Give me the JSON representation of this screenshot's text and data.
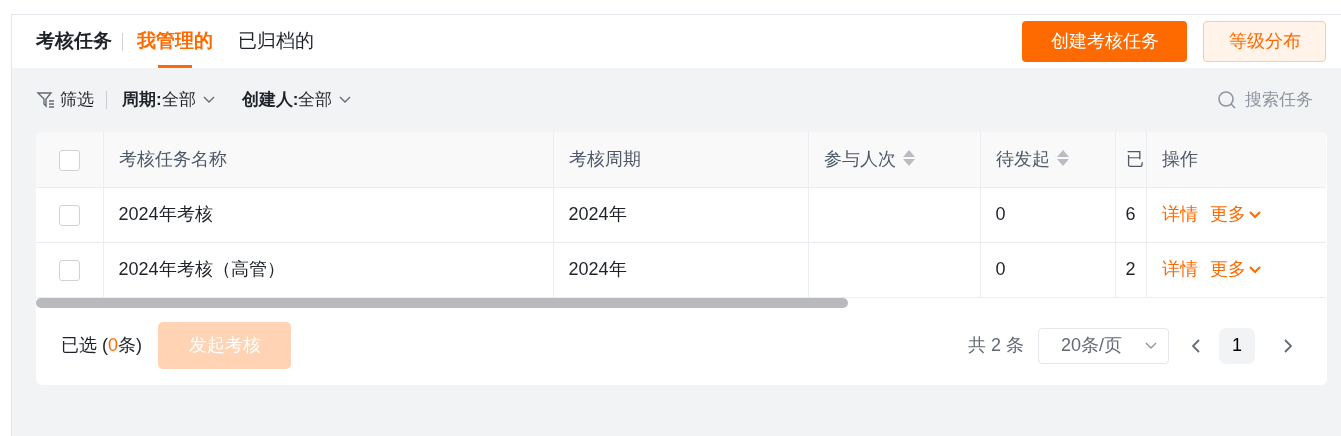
{
  "title": "考核任务",
  "tabs": [
    {
      "label": "我管理的",
      "selected": true
    },
    {
      "label": "已归档的",
      "selected": false
    }
  ],
  "actions": [
    {
      "label": "创建考核任务",
      "kind": "primary"
    },
    {
      "label": "等级分布",
      "kind": "secondary"
    }
  ],
  "filters": {
    "label": "筛选",
    "items": [
      {
        "label": "周期:",
        "value": "全部"
      },
      {
        "label": "创建人:",
        "value": "全部"
      }
    ]
  },
  "search": {
    "placeholder": "搜索任务"
  },
  "table": {
    "select_all": {
      "checked": false
    },
    "columns": [
      {
        "label": "考核任务名称",
        "sortable": false
      },
      {
        "label": "考核周期",
        "sortable": false
      },
      {
        "label": "参与人次",
        "sortable": true
      },
      {
        "label": "待发起",
        "sortable": true
      },
      {
        "label": "已",
        "sortable": false
      },
      {
        "label": "操作",
        "sortable": false
      }
    ],
    "rows": [
      {
        "checked": false,
        "name": "2024年考核",
        "period": "2024年",
        "pending": "0",
        "column_5": "6",
        "actions": [
          "详情",
          "更多"
        ]
      },
      {
        "checked": false,
        "name": "2024年考核（高管）",
        "period": "2024年",
        "pending": "0",
        "column_5": "2",
        "actions": [
          "详情",
          "更多"
        ]
      }
    ]
  },
  "footer": {
    "selected_prefix": "已选 (",
    "selected_count": "0",
    "selected_suffix": "条)",
    "start_button": {
      "label": "发起考核",
      "disabled": true
    }
  },
  "pagination": {
    "total": "共 2 条",
    "page_size": "20条/页",
    "pages": [
      {
        "label": "1",
        "selected": true
      }
    ]
  }
}
